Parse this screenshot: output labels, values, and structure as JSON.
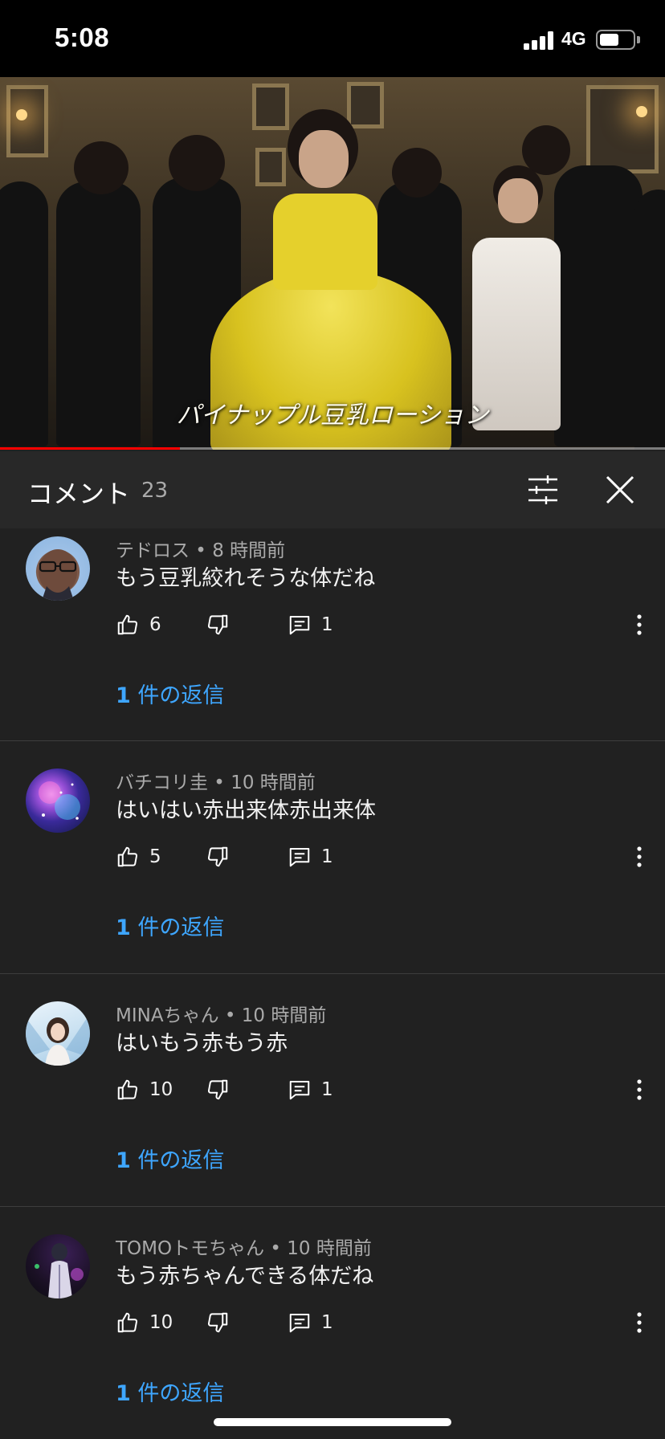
{
  "status_bar": {
    "time": "5:08",
    "network": "4G",
    "battery_level": 0.6
  },
  "video": {
    "subtitle": "パイナップル豆乳ローション",
    "progress": 0.27
  },
  "comments_header": {
    "title": "コメント",
    "count": "23",
    "filter_icon": "tune-icon",
    "close_icon": "close-icon"
  },
  "comments": [
    {
      "author": "テドロス",
      "time": "8 時間前",
      "meta": "テドロス • 8 時間前",
      "text": "もう豆乳絞れそうな体だね",
      "likes": "6",
      "reply_count": "1",
      "replies_count_label": "1",
      "replies_label": " 件の返信"
    },
    {
      "author": "バチコリ圭",
      "time": "10 時間前",
      "meta": "バチコリ圭 • 10 時間前",
      "text": "はいはい赤出来体赤出来体",
      "likes": "5",
      "reply_count": "1",
      "replies_count_label": "1",
      "replies_label": " 件の返信"
    },
    {
      "author": "MINAちゃん",
      "time": "10 時間前",
      "meta": "MINAちゃん • 10 時間前",
      "text": "はいもう赤もう赤",
      "likes": "10",
      "reply_count": "1",
      "replies_count_label": "1",
      "replies_label": " 件の返信"
    },
    {
      "author": "TOMOトモちゃん",
      "time": "10 時間前",
      "meta": "TOMOトモちゃん • 10 時間前",
      "text": "もう赤ちゃんできる体だね",
      "likes": "10",
      "reply_count": "1",
      "replies_count_label": "1",
      "replies_label": " 件の返信"
    }
  ],
  "icons": {
    "like": "thumb-up-icon",
    "dislike": "thumb-down-icon",
    "reply": "reply-icon",
    "more": "more-vert-icon"
  },
  "colors": {
    "background": "#212121",
    "header_bg": "#282828",
    "link_blue": "#3ea6ff",
    "progress_red": "#ff0000"
  }
}
